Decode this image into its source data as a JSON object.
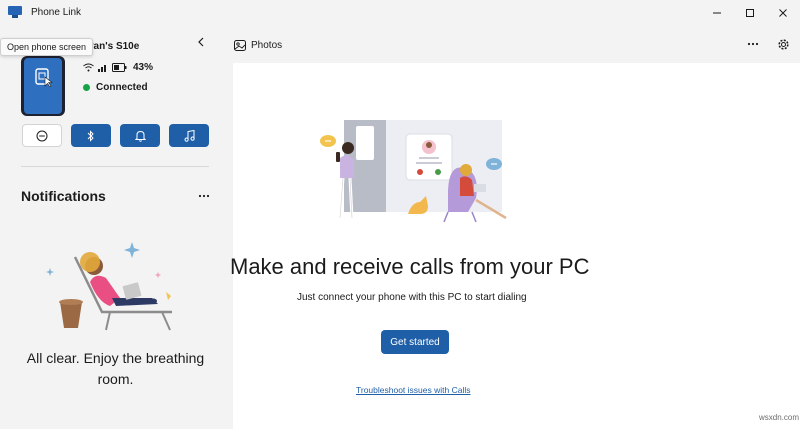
{
  "window": {
    "title": "Phone Link",
    "app_icon": "phone-link-icon",
    "controls": {
      "minimize_icon": "minimize-icon",
      "maximize_icon": "maximize-icon",
      "close_icon": "close-icon"
    }
  },
  "sidebar": {
    "tooltip": "Open phone screen",
    "phone_name": "van's S10e",
    "battery_percent": "43%",
    "connection_status": "Connected",
    "actions": [
      {
        "icon": "do-not-disturb-icon"
      },
      {
        "icon": "bluetooth-icon"
      },
      {
        "icon": "bell-icon"
      },
      {
        "icon": "music-note-icon"
      }
    ],
    "notifications": {
      "title": "Notifications",
      "empty_message": "All clear. Enjoy the breathing room."
    }
  },
  "main": {
    "tab_label": "Photos",
    "headline": "Make and receive calls from your PC",
    "subline": "Just connect your phone with this PC to start dialing",
    "cta_label": "Get started",
    "troubleshoot_link": "Troubleshoot issues with Calls"
  },
  "watermark": "wsxdn.com",
  "colors": {
    "accent": "#1f5fa8",
    "connected": "#16a34a",
    "panel": "#f3f3f3"
  }
}
